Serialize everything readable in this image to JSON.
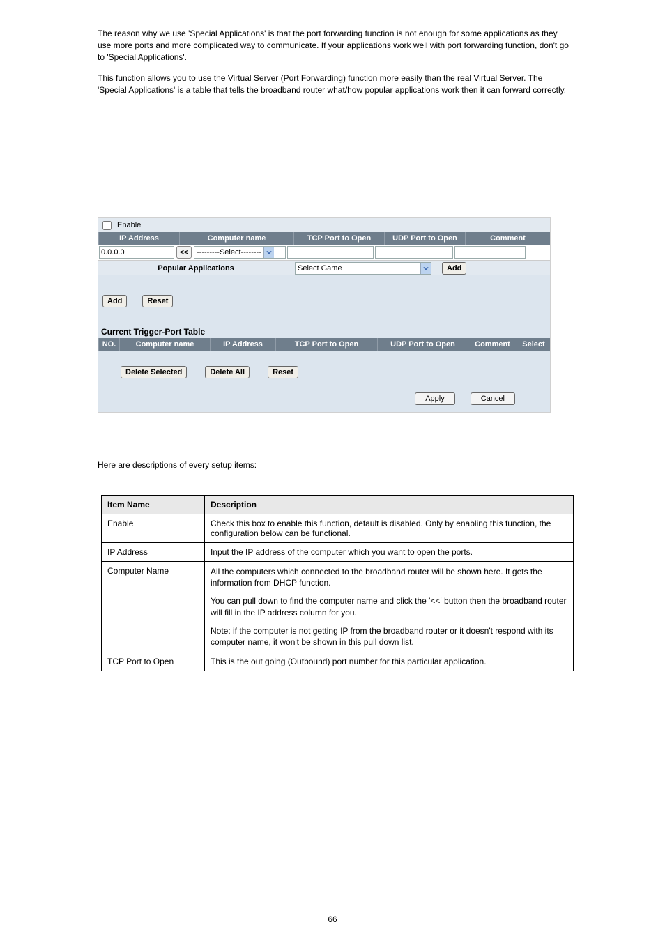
{
  "intro": {
    "p1": "The reason why we use 'Special Applications' is that the port forwarding function is not enough for some applications as they use more ports and more complicated way to communicate. If your applications work well with port forwarding function, don't go to 'Special Applications'.",
    "p2": "This function allows you to use the Virtual Server (Port Forwarding) function more easily than the real Virtual Server. The 'Special Applications' is a table that tells the broadband router what/how popular applications work then it can forward correctly."
  },
  "enable_label": "Enable",
  "header1": {
    "ip": "IP Address",
    "cname": "Computer name",
    "tcp": "TCP Port to Open",
    "udp": "UDP Port to Open",
    "comment": "Comment"
  },
  "ip_value": "0.0.0.0",
  "arrow_label": "<<",
  "computer_select": "---------Select--------",
  "popular_apps_label": "Popular Applications",
  "select_game": "Select Game",
  "add_btn": "Add",
  "reset_btn": "Reset",
  "ctt_title": "Current Trigger-Port Table",
  "ctt_header": {
    "no": "NO.",
    "cname": "Computer name",
    "ip": "IP Address",
    "tcp": "TCP Port to Open",
    "udp": "UDP Port to Open",
    "comment": "Comment",
    "select": "Select"
  },
  "delete_selected": "Delete Selected",
  "delete_all": "Delete All",
  "apply": "Apply",
  "cancel": "Cancel",
  "desc_intro": "Here are descriptions of every setup items:",
  "desc_table": {
    "h1": "Item Name",
    "h2": "Description",
    "rows": [
      {
        "name": "Enable",
        "desc": "Check this box to enable this function, default is disabled. Only by enabling this function, the configuration below can be functional."
      },
      {
        "name": "IP Address",
        "desc": "Input the IP address of the computer which you want to open the ports."
      },
      {
        "name": "Computer Name",
        "desc_p1": "All the computers which connected to the broadband router will be shown here. It gets the information from DHCP function.",
        "desc_p2": "You can pull down to find the computer name and click the '<<' button then the broadband router will fill in the IP address column for you.",
        "desc_p3": "Note: if the computer is not getting IP from the broadband router or it doesn't respond with its computer name, it won't be shown in this pull down list."
      },
      {
        "name": "TCP Port to Open",
        "desc": "This is the out going (Outbound) port number for this particular application."
      }
    ]
  },
  "page_number": "66"
}
